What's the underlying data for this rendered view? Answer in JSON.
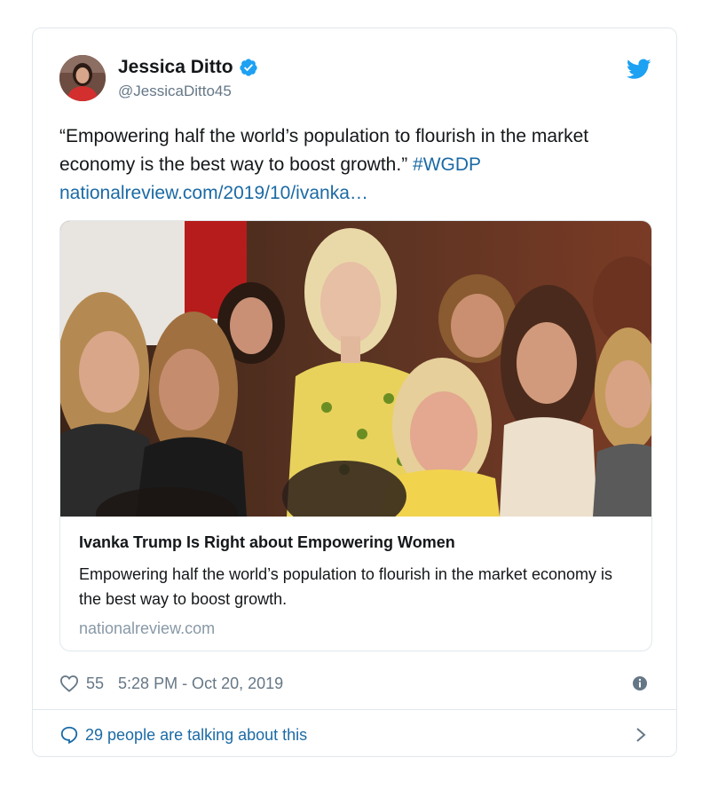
{
  "tweet": {
    "author": {
      "name": "Jessica Ditto",
      "handle": "@JessicaDitto45",
      "verified": true
    },
    "text_line": "“Empowering half the world’s population to flourish in the market economy is the best way to boost growth.”",
    "hashtag": "#WGDP",
    "link": "nationalreview.com/2019/10/ivanka…",
    "card": {
      "title": "Ivanka Trump Is Right about Empowering Women",
      "description": "Empowering half the world’s population to flourish in the market economy is the best way to boost growth.",
      "domain": "nationalreview.com"
    },
    "likes": "55",
    "timestamp": "5:28 PM - Oct 20, 2019",
    "conversation": "29 people are talking about this"
  },
  "colors": {
    "link": "#1b6aa5",
    "verified": "#1da1f2",
    "secondary_text": "#657786",
    "border": "#e1e8ed"
  },
  "icons": {
    "verified": "verified-badge-icon",
    "brand": "twitter-bird-icon",
    "like": "heart-icon",
    "info": "info-icon",
    "reply": "speech-bubble-icon",
    "more": "chevron-right-icon"
  }
}
